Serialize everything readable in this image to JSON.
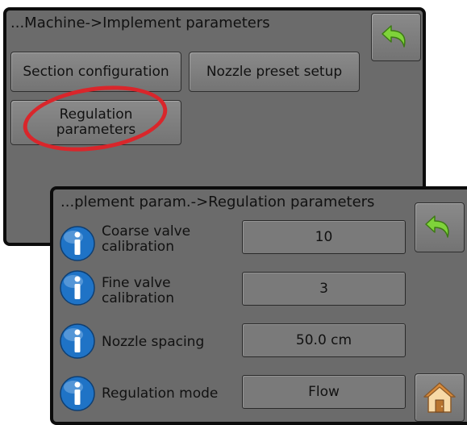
{
  "colors": {
    "panel_bg": "#6b6b6b",
    "panel_border": "#0c0c0c",
    "back_arrow": "#7fd33a",
    "info_icon": "#1f73c6",
    "highlight": "#d9262b"
  },
  "back_panel": {
    "title": "...Machine->Implement parameters",
    "buttons": {
      "section_configuration": "Section configuration",
      "nozzle_preset_setup": "Nozzle preset setup",
      "regulation_parameters_line1": "Regulation",
      "regulation_parameters_line2": "parameters"
    },
    "back_icon": "back-arrow-icon"
  },
  "front_panel": {
    "title": "...plement param.->Regulation parameters",
    "back_icon": "back-arrow-icon",
    "home_icon": "home-icon",
    "rows": [
      {
        "label_line1": "Coarse valve",
        "label_line2": "calibration",
        "value": "10",
        "icon": "info-icon"
      },
      {
        "label_line1": "Fine valve",
        "label_line2": "calibration",
        "value": "3",
        "icon": "info-icon"
      },
      {
        "label_line1": "Nozzle spacing",
        "label_line2": "",
        "value": "50.0 cm",
        "icon": "info-icon"
      },
      {
        "label_line1": "Regulation mode",
        "label_line2": "",
        "value": "Flow",
        "icon": "info-icon"
      }
    ]
  }
}
